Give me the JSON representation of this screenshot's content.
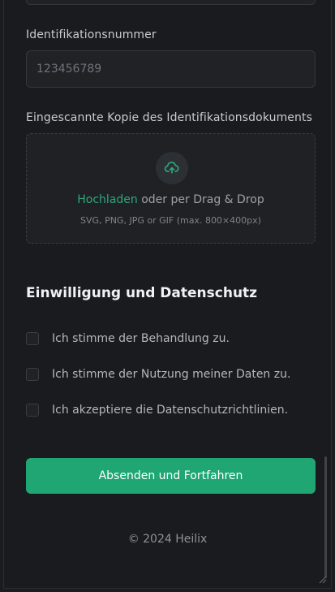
{
  "id_field": {
    "label": "Identifikationsnummer",
    "placeholder": "123456789"
  },
  "upload": {
    "label": "Eingescannte Kopie des Identifikationsdokuments",
    "icon": "upload-cloud-icon",
    "link_text": "Hochladen",
    "rest_text": " oder per Drag & Drop",
    "hint": "SVG, PNG, JPG or GIF (max. 800×400px)",
    "accent_color": "#2ea87a"
  },
  "consent": {
    "title": "Einwilligung und Datenschutz",
    "items": [
      {
        "label": "Ich stimme der Behandlung zu.",
        "checked": false
      },
      {
        "label": "Ich stimme der Nutzung meiner Daten zu.",
        "checked": false
      },
      {
        "label": "Ich akzeptiere die Datenschutzrichtlinien.",
        "checked": false
      }
    ]
  },
  "submit": {
    "label": "Absenden und Fortfahren",
    "color": "#1fa673"
  },
  "footer": {
    "text": "© 2024 Heilix"
  }
}
